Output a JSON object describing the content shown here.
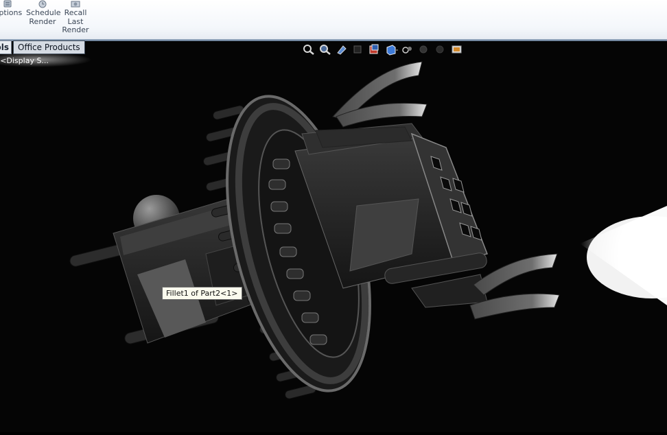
{
  "ribbon": {
    "buttons": [
      {
        "id": "options",
        "label": "Options",
        "icon": "options-icon"
      },
      {
        "id": "schedule-render",
        "label": "Schedule\nRender",
        "icon": "schedule-render-icon"
      },
      {
        "id": "recall-last-render",
        "label": "Recall\nLast\nRender",
        "icon": "recall-render-icon"
      }
    ]
  },
  "tabs": {
    "cut_tab_label": "Tools",
    "active_tab_label": "Office Products"
  },
  "feature_tree": {
    "display_state_text": "Default<Display S..."
  },
  "heads_up_toolbar": [
    "zoom-to-fit-icon",
    "zoom-to-area-icon",
    "previous-view-icon",
    "section-view-icon",
    "dynamic-annotation-icon",
    "view-orientation-icon",
    "display-style-icon",
    "hide-show-items-icon",
    "edit-appearance-icon",
    "apply-scene-icon",
    "view-settings-icon"
  ],
  "tooltip": {
    "text": "Fillet1 of Part2<1>"
  },
  "colors": {
    "viewport_background": "#000000",
    "part_body": "#2a2a2a",
    "part_highlight": "#9a9a9a",
    "ribbon_background": "#f4f7fb"
  }
}
